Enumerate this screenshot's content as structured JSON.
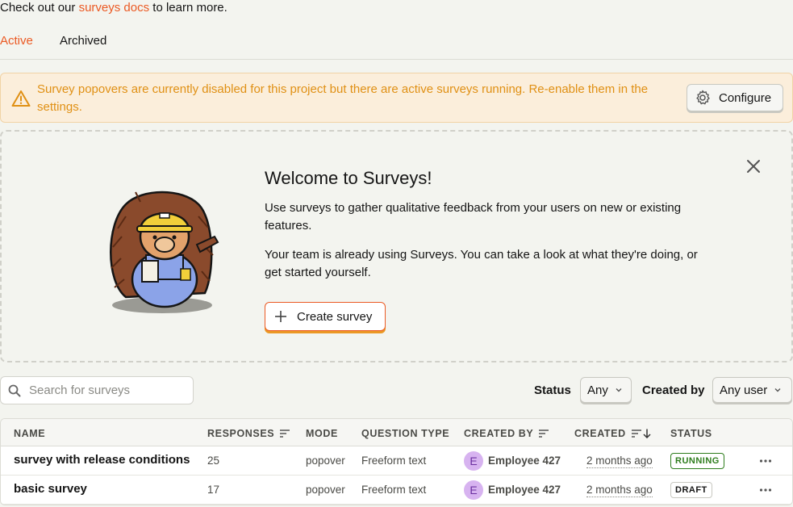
{
  "intro": {
    "prefix": "Check out our ",
    "link": "surveys docs",
    "suffix": " to learn more."
  },
  "tabs": [
    {
      "label": "Active",
      "active": true
    },
    {
      "label": "Archived",
      "active": false
    }
  ],
  "banner": {
    "message": "Survey popovers are currently disabled for this project but there are active surveys running. Re-enable them in the settings.",
    "button": "Configure",
    "color": "#e09014"
  },
  "welcome": {
    "title": "Welcome to Surveys!",
    "p1": "Use surveys to gather qualitative feedback from your users on new or existing features.",
    "p2": "Your team is already using Surveys. You can take a look at what they're doing, or get started yourself.",
    "button": "Create survey"
  },
  "filters": {
    "search_placeholder": "Search for surveys",
    "status_label": "Status",
    "status_value": "Any",
    "created_by_label": "Created by",
    "created_by_value": "Any user"
  },
  "table": {
    "columns": {
      "name": "NAME",
      "responses": "RESPONSES",
      "mode": "MODE",
      "question_type": "QUESTION TYPE",
      "created_by": "CREATED BY",
      "created": "CREATED",
      "status": "STATUS"
    },
    "rows": [
      {
        "name": "survey with release conditions",
        "responses": "25",
        "mode": "popover",
        "question_type": "Freeform text",
        "avatar": "E",
        "created_by": "Employee 427",
        "created": "2 months ago",
        "status": "RUNNING"
      },
      {
        "name": "basic survey",
        "responses": "17",
        "mode": "popover",
        "question_type": "Freeform text",
        "avatar": "E",
        "created_by": "Employee 427",
        "created": "2 months ago",
        "status": "DRAFT"
      }
    ]
  },
  "colors": {
    "accent": "#eb5a24",
    "running": "#2e7d1d",
    "avatar_bg": "#d7b3f0"
  }
}
